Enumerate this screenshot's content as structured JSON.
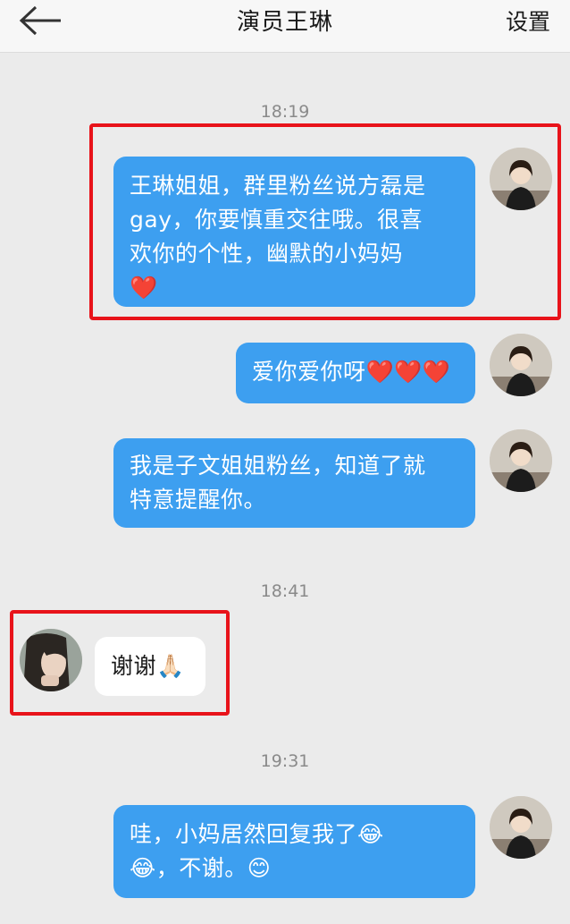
{
  "header": {
    "title": "演员王琳",
    "settings_label": "设置",
    "back_icon": "arrow-left-icon"
  },
  "timestamps": [
    "18:19",
    "18:41",
    "19:31"
  ],
  "messages": [
    {
      "direction": "outgoing",
      "lines": [
        "王琳姐姐，群里粉丝说方磊是",
        "gay，你要慎重交往哦。很喜",
        "欢你的个性，幽默的小妈妈",
        "❤️"
      ]
    },
    {
      "direction": "outgoing",
      "lines": [
        "爱你爱你呀❤️❤️❤️"
      ]
    },
    {
      "direction": "outgoing",
      "lines": [
        "我是子文姐姐粉丝，知道了就",
        "特意提醒你。"
      ]
    },
    {
      "direction": "incoming",
      "lines": [
        "谢谢🙏🏻"
      ]
    },
    {
      "direction": "outgoing",
      "lines": [
        "哇，小妈居然回复我了😂",
        "😂，不谢。😊"
      ]
    }
  ],
  "colors": {
    "outgoing_bubble": "#3d9ff0",
    "incoming_bubble": "#ffffff",
    "highlight_box": "#e8131a",
    "background": "#ebebeb"
  }
}
